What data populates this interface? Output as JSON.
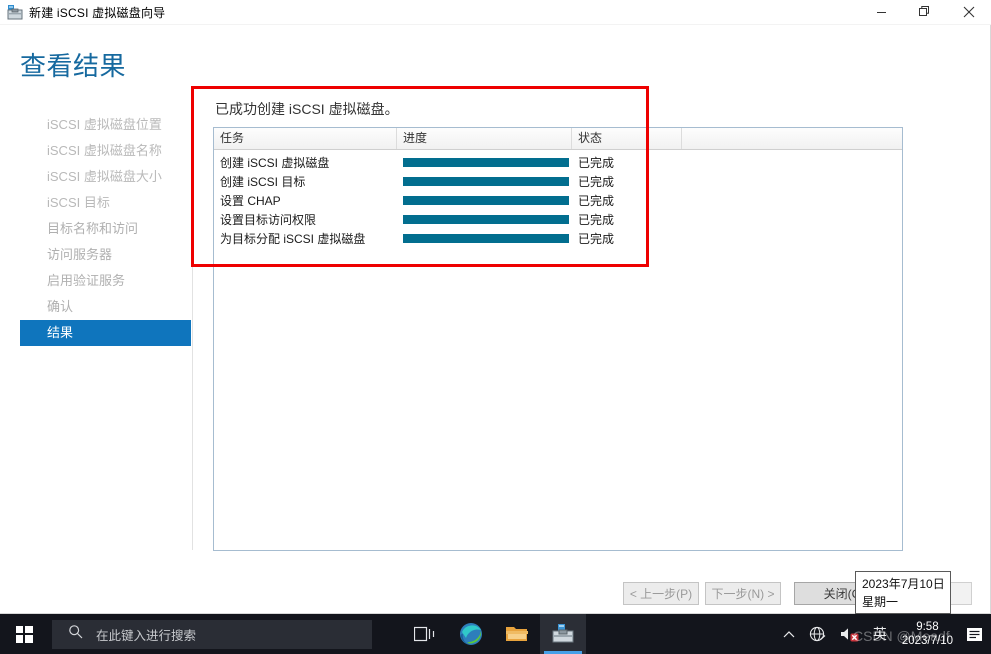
{
  "window": {
    "title": "新建 iSCSI 虚拟磁盘向导",
    "icon": "wizard-toolbox-icon",
    "controls": {
      "minimize": "minimize-icon",
      "restore": "restore-icon",
      "close": "close-icon"
    }
  },
  "page": {
    "heading": "查看结果",
    "result_message": "已成功创建 iSCSI 虚拟磁盘。"
  },
  "sidebar": {
    "items": [
      {
        "label": "iSCSI 虚拟磁盘位置",
        "selected": false
      },
      {
        "label": "iSCSI 虚拟磁盘名称",
        "selected": false
      },
      {
        "label": "iSCSI 虚拟磁盘大小",
        "selected": false
      },
      {
        "label": "iSCSI 目标",
        "selected": false
      },
      {
        "label": "目标名称和访问",
        "selected": false
      },
      {
        "label": "访问服务器",
        "selected": false
      },
      {
        "label": "启用验证服务",
        "selected": false
      },
      {
        "label": "确认",
        "selected": false
      },
      {
        "label": "结果",
        "selected": true
      }
    ]
  },
  "task_table": {
    "columns": [
      "任务",
      "进度",
      "状态",
      ""
    ],
    "rows": [
      {
        "task": "创建 iSCSI 虚拟磁盘",
        "progress": 100,
        "status": "已完成"
      },
      {
        "task": "创建 iSCSI 目标",
        "progress": 100,
        "status": "已完成"
      },
      {
        "task": "设置 CHAP",
        "progress": 100,
        "status": "已完成"
      },
      {
        "task": "设置目标访问权限",
        "progress": 100,
        "status": "已完成"
      },
      {
        "task": "为目标分配 iSCSI 虚拟磁盘",
        "progress": 100,
        "status": "已完成"
      }
    ]
  },
  "footer": {
    "previous": "< 上一步(P)",
    "next": "下一步(N) >",
    "close": "关闭(C)",
    "ghost": ""
  },
  "tooltip": {
    "date": "2023年7月10日",
    "weekday": "星期一"
  },
  "taskbar": {
    "start": "windows-start-icon",
    "search_placeholder": "在此键入进行搜索",
    "search_icon": "search-icon",
    "items": [
      {
        "name": "task-view-icon",
        "active": false
      },
      {
        "name": "edge-browser-icon",
        "active": false
      },
      {
        "name": "file-explorer-icon",
        "active": false
      },
      {
        "name": "server-manager-icon",
        "active": true
      }
    ],
    "tray": {
      "overflow": "chevron-up-icon",
      "network": "network-globe-warning-icon",
      "volume": "speaker-muted-icon",
      "ime": "英",
      "time": "9:58",
      "date": "2023/7/10",
      "notifications": "notification-center-icon"
    }
  },
  "watermark": "CSDN @Meadf",
  "colors": {
    "accent_blue": "#0f75bd",
    "heading_blue": "#16699f",
    "progress_teal": "#026e8f",
    "annotation_red": "#ee0000",
    "taskbar_bg": "#13151c"
  }
}
